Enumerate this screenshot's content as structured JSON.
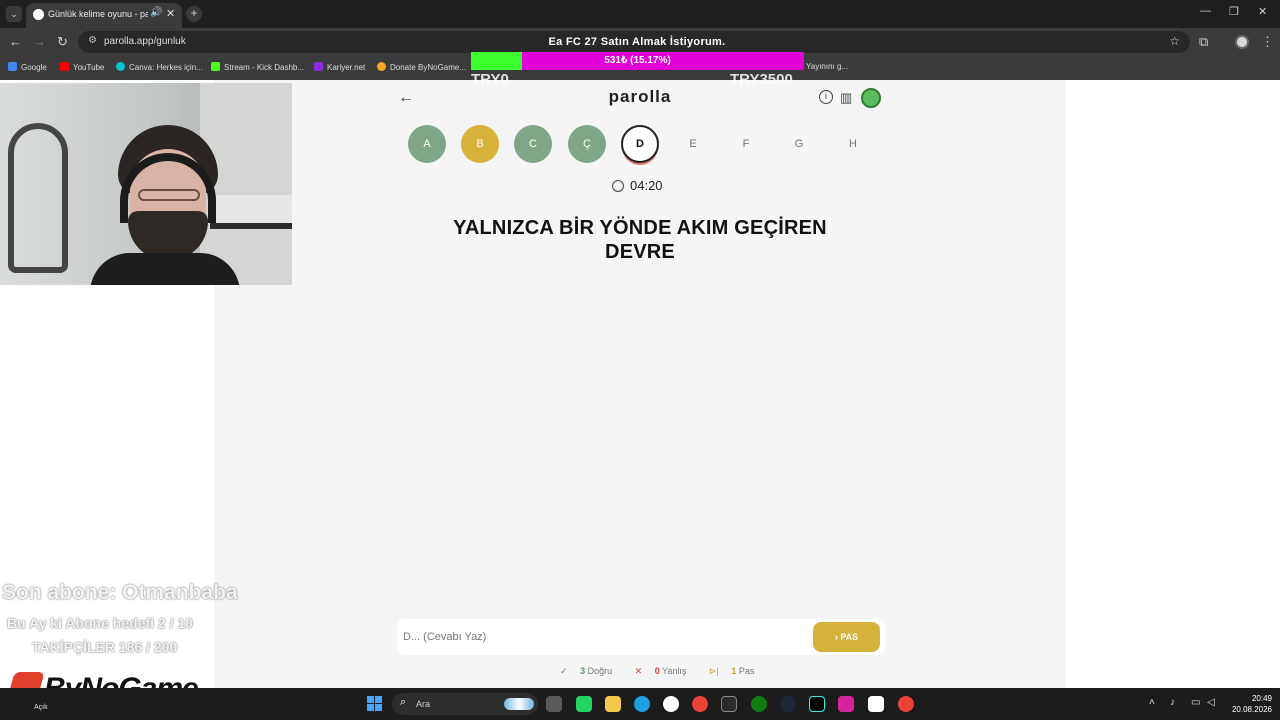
{
  "browser": {
    "tab": {
      "title": "Günlük kelime oyunu - parolla"
    },
    "url": "parolla.app/gunluk",
    "bookmarks": [
      {
        "label": "Google",
        "color": "#4285f4"
      },
      {
        "label": "YouTube",
        "color": "#ff0000"
      },
      {
        "label": "Canva: Herkes için...",
        "color": "#00c4cc"
      },
      {
        "label": "Stream - Kick Dashb...",
        "color": "#53fc18"
      },
      {
        "label": "Kariyer.net",
        "color": "#8a2be2"
      },
      {
        "label": "Donate ByNoGame...",
        "color": "#f5a623"
      },
      {
        "label": "Yayınını g...",
        "color": "#9e9e9e"
      }
    ]
  },
  "donation_goal": {
    "title": "Ea FC 27 Satın Almak İstiyorum.",
    "progress_text": "531₺ (15.17%)",
    "progress_fraction": 0.1517,
    "min_label": "TRY0",
    "max_label": "TRY3500",
    "fill_color": "#3bff2e",
    "bar_color": "#e000d8"
  },
  "game": {
    "logo": "parolla",
    "letters": [
      {
        "char": "A",
        "state": "correct"
      },
      {
        "char": "B",
        "state": "passed"
      },
      {
        "char": "C",
        "state": "correct"
      },
      {
        "char": "Ç",
        "state": "correct"
      },
      {
        "char": "D",
        "state": "current"
      },
      {
        "char": "E",
        "state": "pending"
      },
      {
        "char": "F",
        "state": "pending"
      },
      {
        "char": "G",
        "state": "pending"
      },
      {
        "char": "H",
        "state": "pending"
      }
    ],
    "timer": "04:20",
    "question_line1": "YALNIZCA BİR YÖNDE AKIM GEÇİREN",
    "question_line2": "DEVRE",
    "answer_placeholder": "D... (Cevabı Yaz)",
    "pas_label": "PAS",
    "stats": {
      "correct_count": "3",
      "correct_label": "Doğru",
      "wrong_count": "0",
      "wrong_label": "Yanlış",
      "pass_count": "1",
      "pass_label": "Pas"
    }
  },
  "stream_overlay": {
    "last_sub": "Son abone: Otmanbaba",
    "sub_goal": "Bu Ay ki Abone hedefi 2 / 10",
    "followers": "TAKİPÇİLER 186 / 200",
    "brand": "ByNoGame"
  },
  "taskbar": {
    "weather_text": "Açık",
    "search_placeholder": "Ara",
    "time": "20:49",
    "date": "20.08.2026"
  }
}
